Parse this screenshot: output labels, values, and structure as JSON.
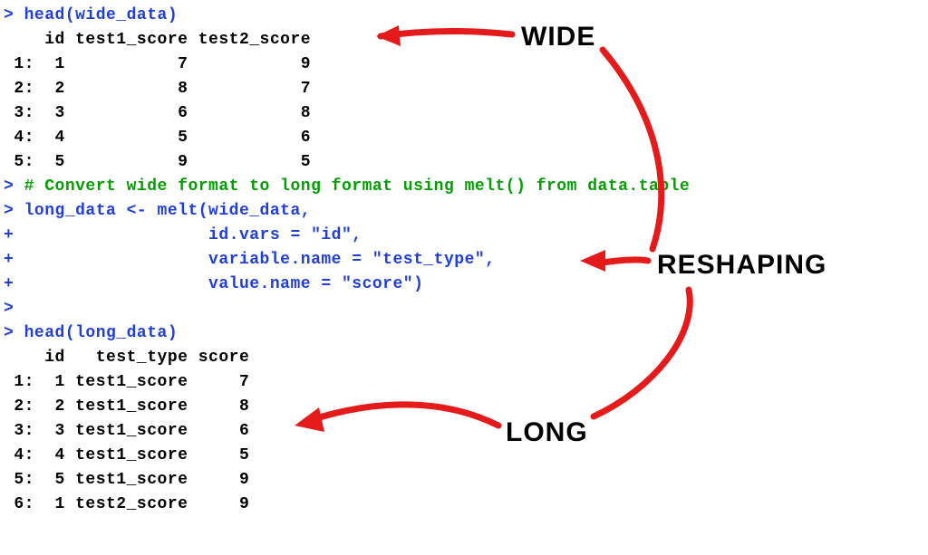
{
  "console_lines": [
    {
      "type": "cmd",
      "prompt": ">",
      "text": " head(wide_data)"
    },
    {
      "type": "plain",
      "prompt": " ",
      "text": "   id test1_score test2_score"
    },
    {
      "type": "plain",
      "prompt": " ",
      "text": "1:  1           7           9"
    },
    {
      "type": "plain",
      "prompt": " ",
      "text": "2:  2           8           7"
    },
    {
      "type": "plain",
      "prompt": " ",
      "text": "3:  3           6           8"
    },
    {
      "type": "plain",
      "prompt": " ",
      "text": "4:  4           5           6"
    },
    {
      "type": "plain",
      "prompt": " ",
      "text": "5:  5           9           5"
    },
    {
      "type": "comment",
      "prompt": ">",
      "text": " # Convert wide format to long format using melt() from data.table"
    },
    {
      "type": "cmd",
      "prompt": ">",
      "text": " long_data <- melt(wide_data,"
    },
    {
      "type": "cmd",
      "prompt": "+",
      "text": "                   id.vars = \"id\","
    },
    {
      "type": "cmd",
      "prompt": "+",
      "text": "                   variable.name = \"test_type\","
    },
    {
      "type": "cmd",
      "prompt": "+",
      "text": "                   value.name = \"score\")"
    },
    {
      "type": "cmd",
      "prompt": ">",
      "text": ""
    },
    {
      "type": "cmd",
      "prompt": ">",
      "text": " head(long_data)"
    },
    {
      "type": "plain",
      "prompt": " ",
      "text": "   id   test_type score"
    },
    {
      "type": "plain",
      "prompt": " ",
      "text": "1:  1 test1_score     7"
    },
    {
      "type": "plain",
      "prompt": " ",
      "text": "2:  2 test1_score     8"
    },
    {
      "type": "plain",
      "prompt": " ",
      "text": "3:  3 test1_score     6"
    },
    {
      "type": "plain",
      "prompt": " ",
      "text": "4:  4 test1_score     5"
    },
    {
      "type": "plain",
      "prompt": " ",
      "text": "5:  5 test1_score     9"
    },
    {
      "type": "plain",
      "prompt": " ",
      "text": "6:  1 test2_score     9"
    }
  ],
  "labels": {
    "wide": "WIDE",
    "reshaping": "RESHAPING",
    "long": "LONG"
  },
  "colors": {
    "arrow": "#e51a1a"
  }
}
